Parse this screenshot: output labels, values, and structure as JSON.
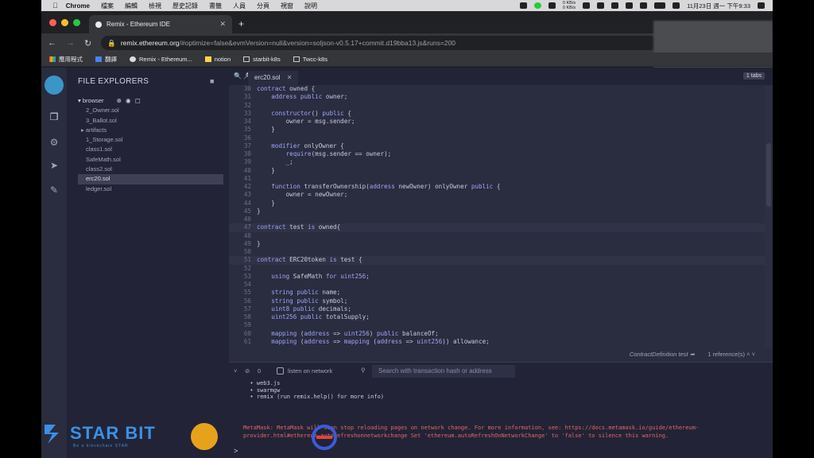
{
  "menubar": {
    "app": "Chrome",
    "items": [
      "檔案",
      "編輯",
      "檢視",
      "歷史記錄",
      "書籤",
      "人員",
      "分頁",
      "視窗",
      "說明"
    ],
    "net_up": "0 KB/s",
    "net_down": "0 KB/s",
    "clock": "11月23日 週一 下午9:33"
  },
  "browser": {
    "tab_title": "Remix - Ethereum IDE",
    "url_host": "remix.ethereum.org",
    "url_rest": "/#optimize=false&evmVersion=null&version=soljson-v0.5.17+commit.d19bba13.js&runs=200",
    "bookmarks": [
      "應用程式",
      "翻譯",
      "Remix - Ethereum...",
      "notion",
      "starbit-k8s",
      "Twcc-k8s"
    ]
  },
  "file_explorer": {
    "title": "FILE EXPLORERS",
    "root": "browser",
    "items": [
      {
        "label": "2_Owner.sol",
        "indent": 1
      },
      {
        "label": "3_Ballot.sol",
        "indent": 1
      },
      {
        "label": "artifacts",
        "indent": 0,
        "folder": true
      },
      {
        "label": "1_Storage.sol",
        "indent": 1
      },
      {
        "label": "class1.sol",
        "indent": 1
      },
      {
        "label": "SafeMath.sol",
        "indent": 1
      },
      {
        "label": "class2.sol",
        "indent": 1
      },
      {
        "label": "erc20.sol",
        "indent": 1,
        "selected": true
      },
      {
        "label": "ledger.sol",
        "indent": 1
      }
    ]
  },
  "editor": {
    "active_tab": "erc20.sol",
    "tabs_badge": "1 tabs",
    "highlight_lines": [
      47,
      51
    ],
    "lines": [
      {
        "n": 30,
        "t": "contract owned {"
      },
      {
        "n": 31,
        "t": "    address public owner;"
      },
      {
        "n": 32,
        "t": ""
      },
      {
        "n": 33,
        "t": "    constructor() public {"
      },
      {
        "n": 34,
        "t": "        owner = msg.sender;"
      },
      {
        "n": 35,
        "t": "    }"
      },
      {
        "n": 36,
        "t": ""
      },
      {
        "n": 37,
        "t": "    modifier onlyOwner {"
      },
      {
        "n": 38,
        "t": "        require(msg.sender == owner);"
      },
      {
        "n": 39,
        "t": "        _;"
      },
      {
        "n": 40,
        "t": "    }"
      },
      {
        "n": 41,
        "t": ""
      },
      {
        "n": 42,
        "t": "    function transferOwnership(address newOwner) onlyOwner public {"
      },
      {
        "n": 43,
        "t": "        owner = newOwner;"
      },
      {
        "n": 44,
        "t": "    }"
      },
      {
        "n": 45,
        "t": "}"
      },
      {
        "n": 46,
        "t": ""
      },
      {
        "n": 47,
        "t": "contract test is owned{"
      },
      {
        "n": 48,
        "t": ""
      },
      {
        "n": 49,
        "t": "}"
      },
      {
        "n": 50,
        "t": ""
      },
      {
        "n": 51,
        "t": "contract ERC20token is test {"
      },
      {
        "n": 52,
        "t": ""
      },
      {
        "n": 53,
        "t": "    using SafeMath for uint256;"
      },
      {
        "n": 54,
        "t": ""
      },
      {
        "n": 55,
        "t": "    string public name;"
      },
      {
        "n": 56,
        "t": "    string public symbol;"
      },
      {
        "n": 57,
        "t": "    uint8 public decimals;"
      },
      {
        "n": 58,
        "t": "    uint256 public totalSupply;"
      },
      {
        "n": 59,
        "t": ""
      },
      {
        "n": 60,
        "t": "    mapping (address => uint256) public balanceOf;"
      },
      {
        "n": 61,
        "t": "    mapping (address => mapping (address => uint256)) allowance;"
      }
    ],
    "reference_label": "ContractDefinition test",
    "reference_count": "1 reference(s)"
  },
  "terminal": {
    "pending_count": "0",
    "listen_label": "listen on network",
    "search_placeholder": "Search with transaction hash or address",
    "output": [
      "  • web3.js",
      "  • swarmgw",
      "  • remix (run remix.help() for more info)"
    ],
    "warning": "MetaMask: MetaMask will soon stop reloading pages on network change. For more information, see: https://docs.metamask.io/guide/ethereum-provider.html#ethereum-autorefreshonnetworkchange Set 'ethereum.autoRefreshOnNetworkChange' to 'false' to silence this warning.",
    "prompt": ">"
  },
  "watermarks": {
    "starbit_name": "STAR BIT",
    "starbit_tagline": "Be a blockchain STAR"
  }
}
